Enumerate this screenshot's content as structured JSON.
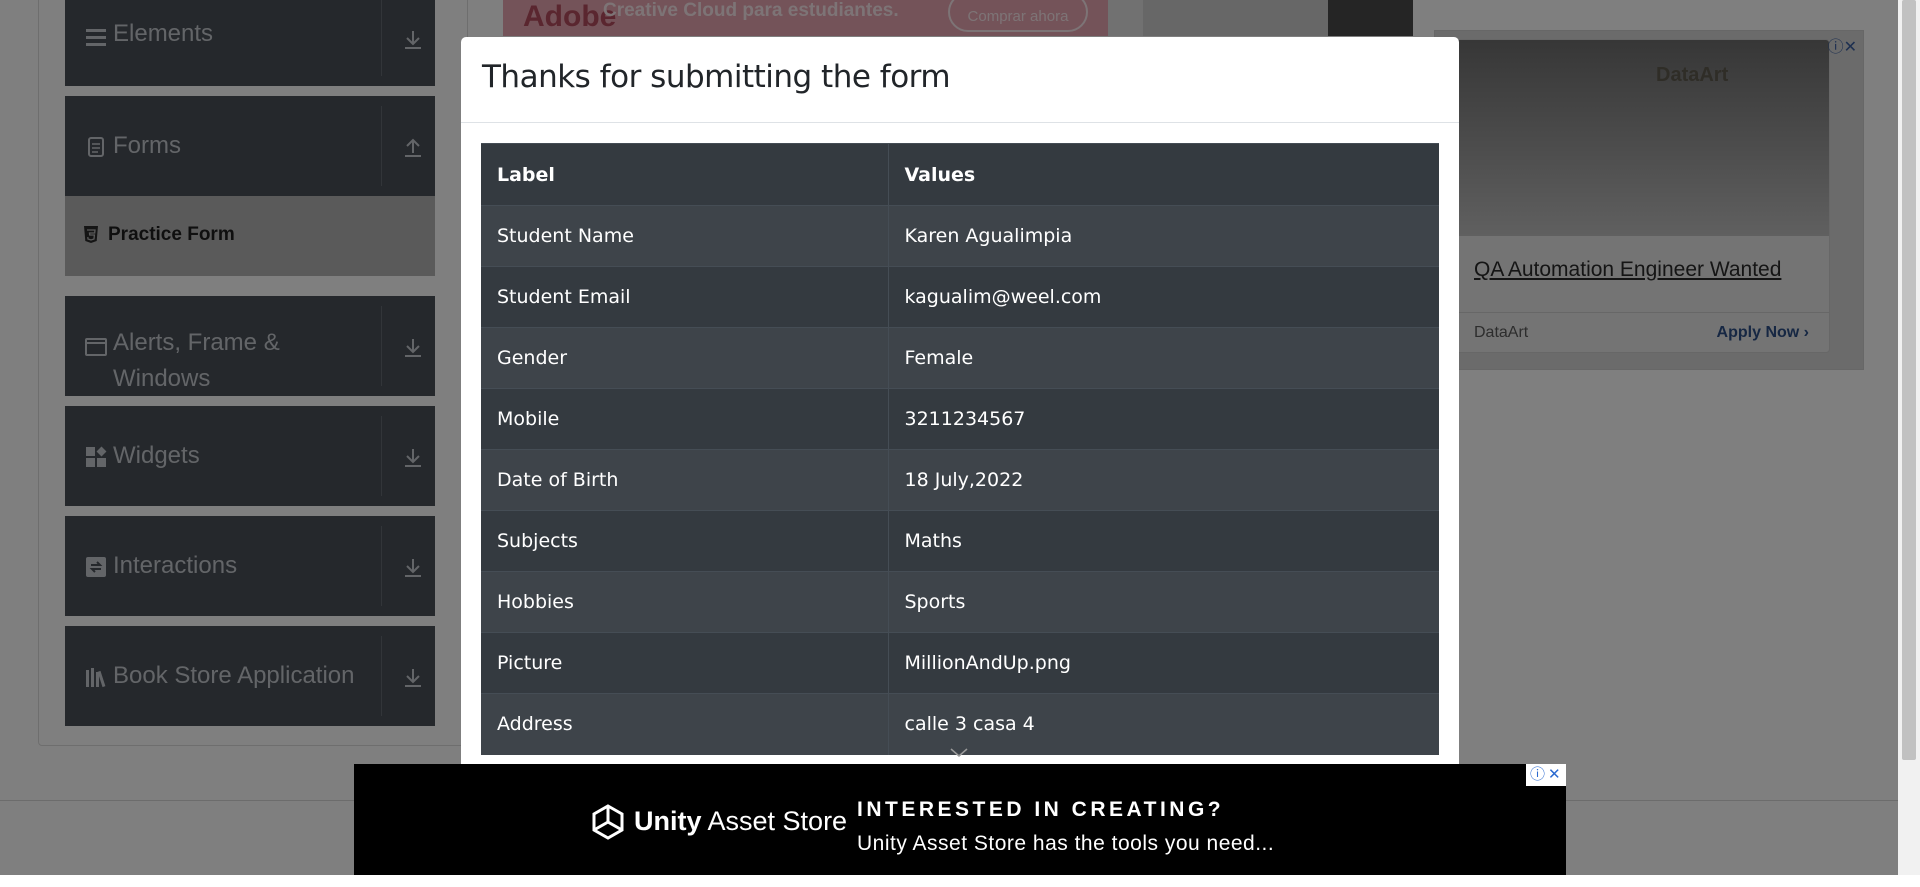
{
  "sidebar": {
    "groups": [
      {
        "label": "Elements",
        "icon": "hamburger-icon",
        "arrow": "download-arrow-icon"
      },
      {
        "label": "Forms",
        "icon": "document-icon",
        "arrow": "upload-arrow-icon"
      },
      {
        "label": "Alerts, Frame &",
        "label2": "Windows",
        "icon": "window-icon",
        "arrow": "download-arrow-icon"
      },
      {
        "label": "Widgets",
        "icon": "widgets-icon",
        "arrow": "download-arrow-icon"
      },
      {
        "label": "Interactions",
        "icon": "interactions-icon",
        "arrow": "download-arrow-icon"
      },
      {
        "label": "Book Store Application",
        "icon": "books-icon",
        "arrow": "download-arrow-icon"
      }
    ],
    "active_item": {
      "label": "Practice Form",
      "icon": "html5-icon"
    }
  },
  "top_ad": {
    "logo": "Adobe",
    "headline": "Creative Cloud para estudiantes.",
    "button": "Comprar ahora"
  },
  "right_ad": {
    "brand": "DataArt",
    "heading": "QA Automation Engineer Wanted",
    "company": "DataArt",
    "cta": "Apply Now"
  },
  "modal": {
    "title": "Thanks for submitting the form",
    "columns": [
      "Label",
      "Values"
    ],
    "rows": [
      {
        "label": "Student Name",
        "value": "Karen Agualimpia"
      },
      {
        "label": "Student Email",
        "value": "kagualim@weel.com"
      },
      {
        "label": "Gender",
        "value": "Female"
      },
      {
        "label": "Mobile",
        "value": "3211234567"
      },
      {
        "label": "Date of Birth",
        "value": "18 July,2022"
      },
      {
        "label": "Subjects",
        "value": "Maths"
      },
      {
        "label": "Hobbies",
        "value": "Sports"
      },
      {
        "label": "Picture",
        "value": "MillionAndUp.png"
      },
      {
        "label": "Address",
        "value": "calle 3 casa 4"
      }
    ]
  },
  "bottom_ad": {
    "brand_bold": "Unity",
    "brand_rest": " Asset Store",
    "headline": "INTERESTED IN CREATING?",
    "subline": "Unity Asset Store has the tools you need..."
  },
  "colors": {
    "sidebar_bg": "#4a5058",
    "table_dark": "#343a40",
    "table_stripe": "#3e444a",
    "overlay": "rgba(0,0,0,0.5)",
    "ad_link": "#2b6ad0"
  }
}
